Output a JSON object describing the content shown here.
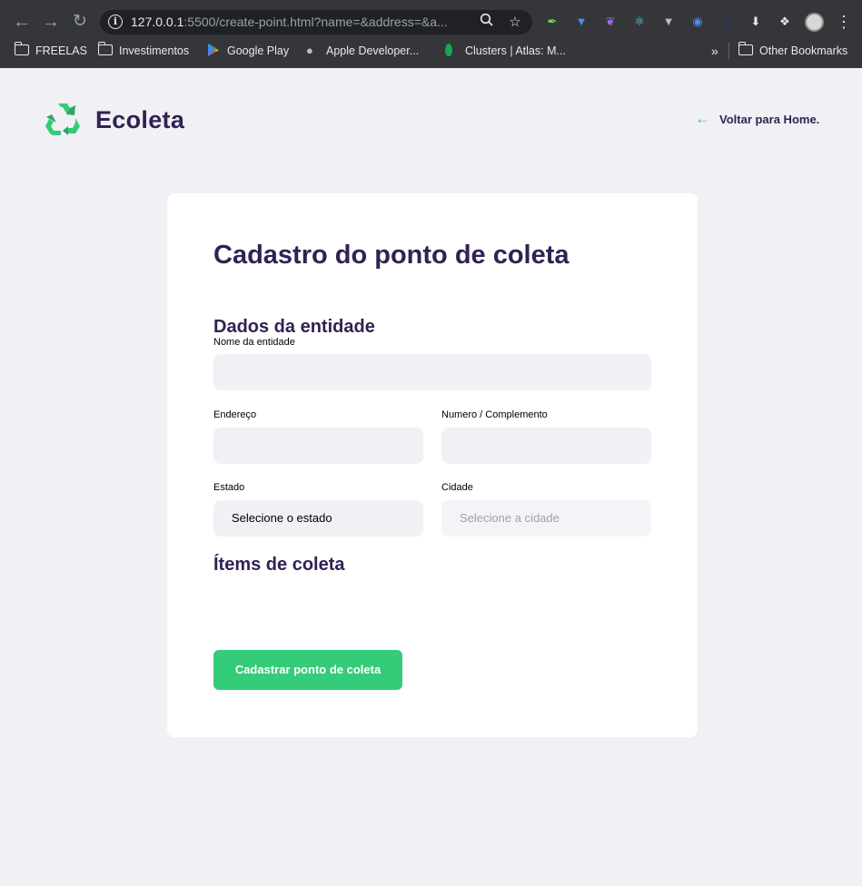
{
  "browser": {
    "url_host": "127.0.0.1",
    "url_rest": ":5500/create-point.html?name=&address=&a...",
    "bookmarks": [
      {
        "label": "FREELAS",
        "icon": "folder-icon"
      },
      {
        "label": "Investimentos",
        "icon": "folder-icon"
      },
      {
        "label": "Google Play",
        "icon": "google-play-icon"
      },
      {
        "label": "Apple Developer...",
        "icon": "apple-icon"
      },
      {
        "label": "Clusters | Atlas: M...",
        "icon": "mongodb-leaf-icon"
      }
    ],
    "overflow": "»",
    "other_bookmarks": "Other Bookmarks"
  },
  "header": {
    "brand": "Ecoleta",
    "back_link": "Voltar para Home."
  },
  "form": {
    "title": "Cadastro do ponto de coleta",
    "section_entity": "Dados da entidade",
    "name_label": "Nome da entidade",
    "name_value": "",
    "address_label": "Endereço",
    "address_value": "",
    "number_label": "Numero / Complemento",
    "number_value": "",
    "state_label": "Estado",
    "state_selected": "Selecione o estado",
    "city_label": "Cidade",
    "city_selected": "Selecione a cidade",
    "section_items": "Ítems de coleta",
    "submit_label": "Cadastrar ponto de coleta"
  },
  "colors": {
    "brand_purple": "#322153",
    "accent_green": "#34cb79",
    "page_bg": "#f0f0f5",
    "field_bg": "#f0f0f5"
  }
}
